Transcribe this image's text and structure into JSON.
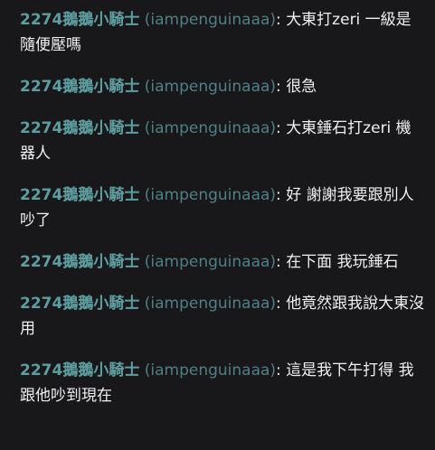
{
  "theme": {
    "background": "#18181b",
    "text": "#efeff1",
    "username_color": "#5f9ea0",
    "login_color": "#4e8085"
  },
  "messages": [
    {
      "display_name": "2274鵝鵝小騎士",
      "login": "(iampenguinaaa)",
      "separator": ":",
      "text": "大東打zeri 一級是隨便壓嗎"
    },
    {
      "display_name": "2274鵝鵝小騎士",
      "login": "(iampenguinaaa)",
      "separator": ":",
      "text": "很急"
    },
    {
      "display_name": "2274鵝鵝小騎士",
      "login": "(iampenguinaaa)",
      "separator": ":",
      "text": "大東錘石打zeri 機器人"
    },
    {
      "display_name": "2274鵝鵝小騎士",
      "login": "(iampenguinaaa)",
      "separator": ":",
      "text": "好 謝謝我要跟別人吵了"
    },
    {
      "display_name": "2274鵝鵝小騎士",
      "login": "(iampenguinaaa)",
      "separator": ":",
      "text": "在下面 我玩錘石"
    },
    {
      "display_name": "2274鵝鵝小騎士",
      "login": "(iampenguinaaa)",
      "separator": ":",
      "text": "他竟然跟我說大東沒用"
    },
    {
      "display_name": "2274鵝鵝小騎士",
      "login": "(iampenguinaaa)",
      "separator": ":",
      "text": "這是我下午打得 我跟他吵到現在"
    }
  ]
}
